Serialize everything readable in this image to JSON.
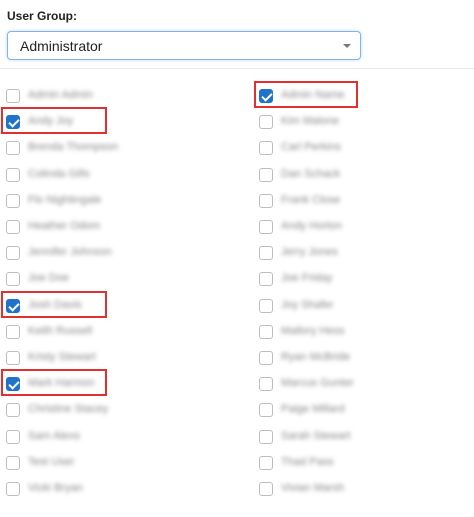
{
  "user_group": {
    "label": "User Group:",
    "selected": "Administrator"
  },
  "users_left": [
    {
      "name": "Admin Admin",
      "checked": false
    },
    {
      "name": "Andy Joy",
      "checked": true
    },
    {
      "name": "Brenda Thompson",
      "checked": false
    },
    {
      "name": "Colinda Gills",
      "checked": false
    },
    {
      "name": "Flo Nightingale",
      "checked": false
    },
    {
      "name": "Heather Odom",
      "checked": false
    },
    {
      "name": "Jennifer Johnson",
      "checked": false
    },
    {
      "name": "Joe Doe",
      "checked": false
    },
    {
      "name": "Josh Davis",
      "checked": true
    },
    {
      "name": "Keith Russell",
      "checked": false
    },
    {
      "name": "Kristy Stewart",
      "checked": false
    },
    {
      "name": "Mark Harmon",
      "checked": true
    },
    {
      "name": "Christine Stacey",
      "checked": false
    },
    {
      "name": "Sam Alexs",
      "checked": false
    },
    {
      "name": "Test User",
      "checked": false
    },
    {
      "name": "Vicki Bryan",
      "checked": false
    }
  ],
  "users_right": [
    {
      "name": "Admin Name",
      "checked": true
    },
    {
      "name": "Kim Malone",
      "checked": false
    },
    {
      "name": "Carl Perkins",
      "checked": false
    },
    {
      "name": "Dan Schack",
      "checked": false
    },
    {
      "name": "Frank Close",
      "checked": false
    },
    {
      "name": "Andy Horton",
      "checked": false
    },
    {
      "name": "Jerry Jones",
      "checked": false
    },
    {
      "name": "Joe Friday",
      "checked": false
    },
    {
      "name": "Joy Shafer",
      "checked": false
    },
    {
      "name": "Mallory Hess",
      "checked": false
    },
    {
      "name": "Ryan McBride",
      "checked": false
    },
    {
      "name": "Marcus Gunter",
      "checked": false
    },
    {
      "name": "Paige Millard",
      "checked": false
    },
    {
      "name": "Sarah Stewart",
      "checked": false
    },
    {
      "name": "Thad Pass",
      "checked": false
    },
    {
      "name": "Vivian Marsh",
      "checked": false
    }
  ]
}
